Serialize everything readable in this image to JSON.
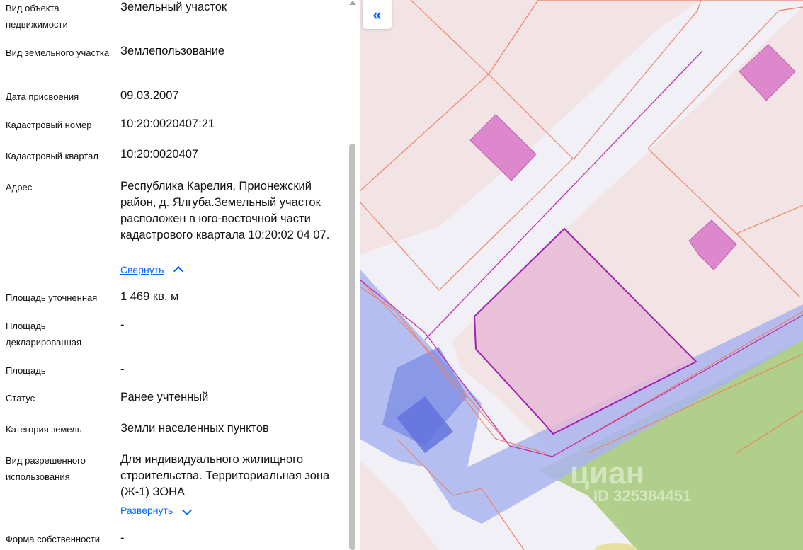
{
  "fields": [
    {
      "label": "Вид объекта недвижимости",
      "value": "Земельный участок"
    },
    {
      "label": "Вид земельного участка",
      "value": "Землепользование"
    },
    {
      "label": "Дата присвоения",
      "value": "09.03.2007"
    },
    {
      "label": "Кадастровый номер",
      "value": "10:20:0020407:21"
    },
    {
      "label": "Кадастровый квартал",
      "value": "10:20:0020407"
    },
    {
      "label": "Адрес",
      "value": "Республика Карелия, Прионежский район, д. Ялгуба.Земельный участок расположен в юго-восточной части кадастрового квартала 10:20:02 04 07.",
      "link": "Свернуть",
      "link_state": "expanded"
    },
    {
      "label": "Площадь уточненная",
      "value": "1 469 кв. м"
    },
    {
      "label": "Площадь декларированная",
      "value": "-"
    },
    {
      "label": "Площадь",
      "value": "-"
    },
    {
      "label": "Статус",
      "value": "Ранее учтенный"
    },
    {
      "label": "Категория земель",
      "value": "Земли населенных пунктов"
    },
    {
      "label": "Вид разрешенного использования",
      "value": "Для индивидуального жилищного строительства. Территориальная зона (Ж-1) ЗОНА",
      "link": "Развернуть",
      "link_state": "collapsed"
    },
    {
      "label": "Форма собственности",
      "value": "-"
    }
  ],
  "map": {
    "collapse_icon": "double-chevron-left-icon",
    "collapse_glyph": "«",
    "watermark_brand": "циан",
    "watermark_id": "ID 325384451",
    "colors": {
      "parcel_fill": "#f2e4e4",
      "parcel_line": "#f08068",
      "selected_fill": "#e6bad6",
      "selected_line": "#a020b0",
      "building": "#dd88cc",
      "road": "#f0f0f6",
      "water": "#aab5ee",
      "green": "#a8cc80",
      "accent": "#0468ff"
    }
  }
}
